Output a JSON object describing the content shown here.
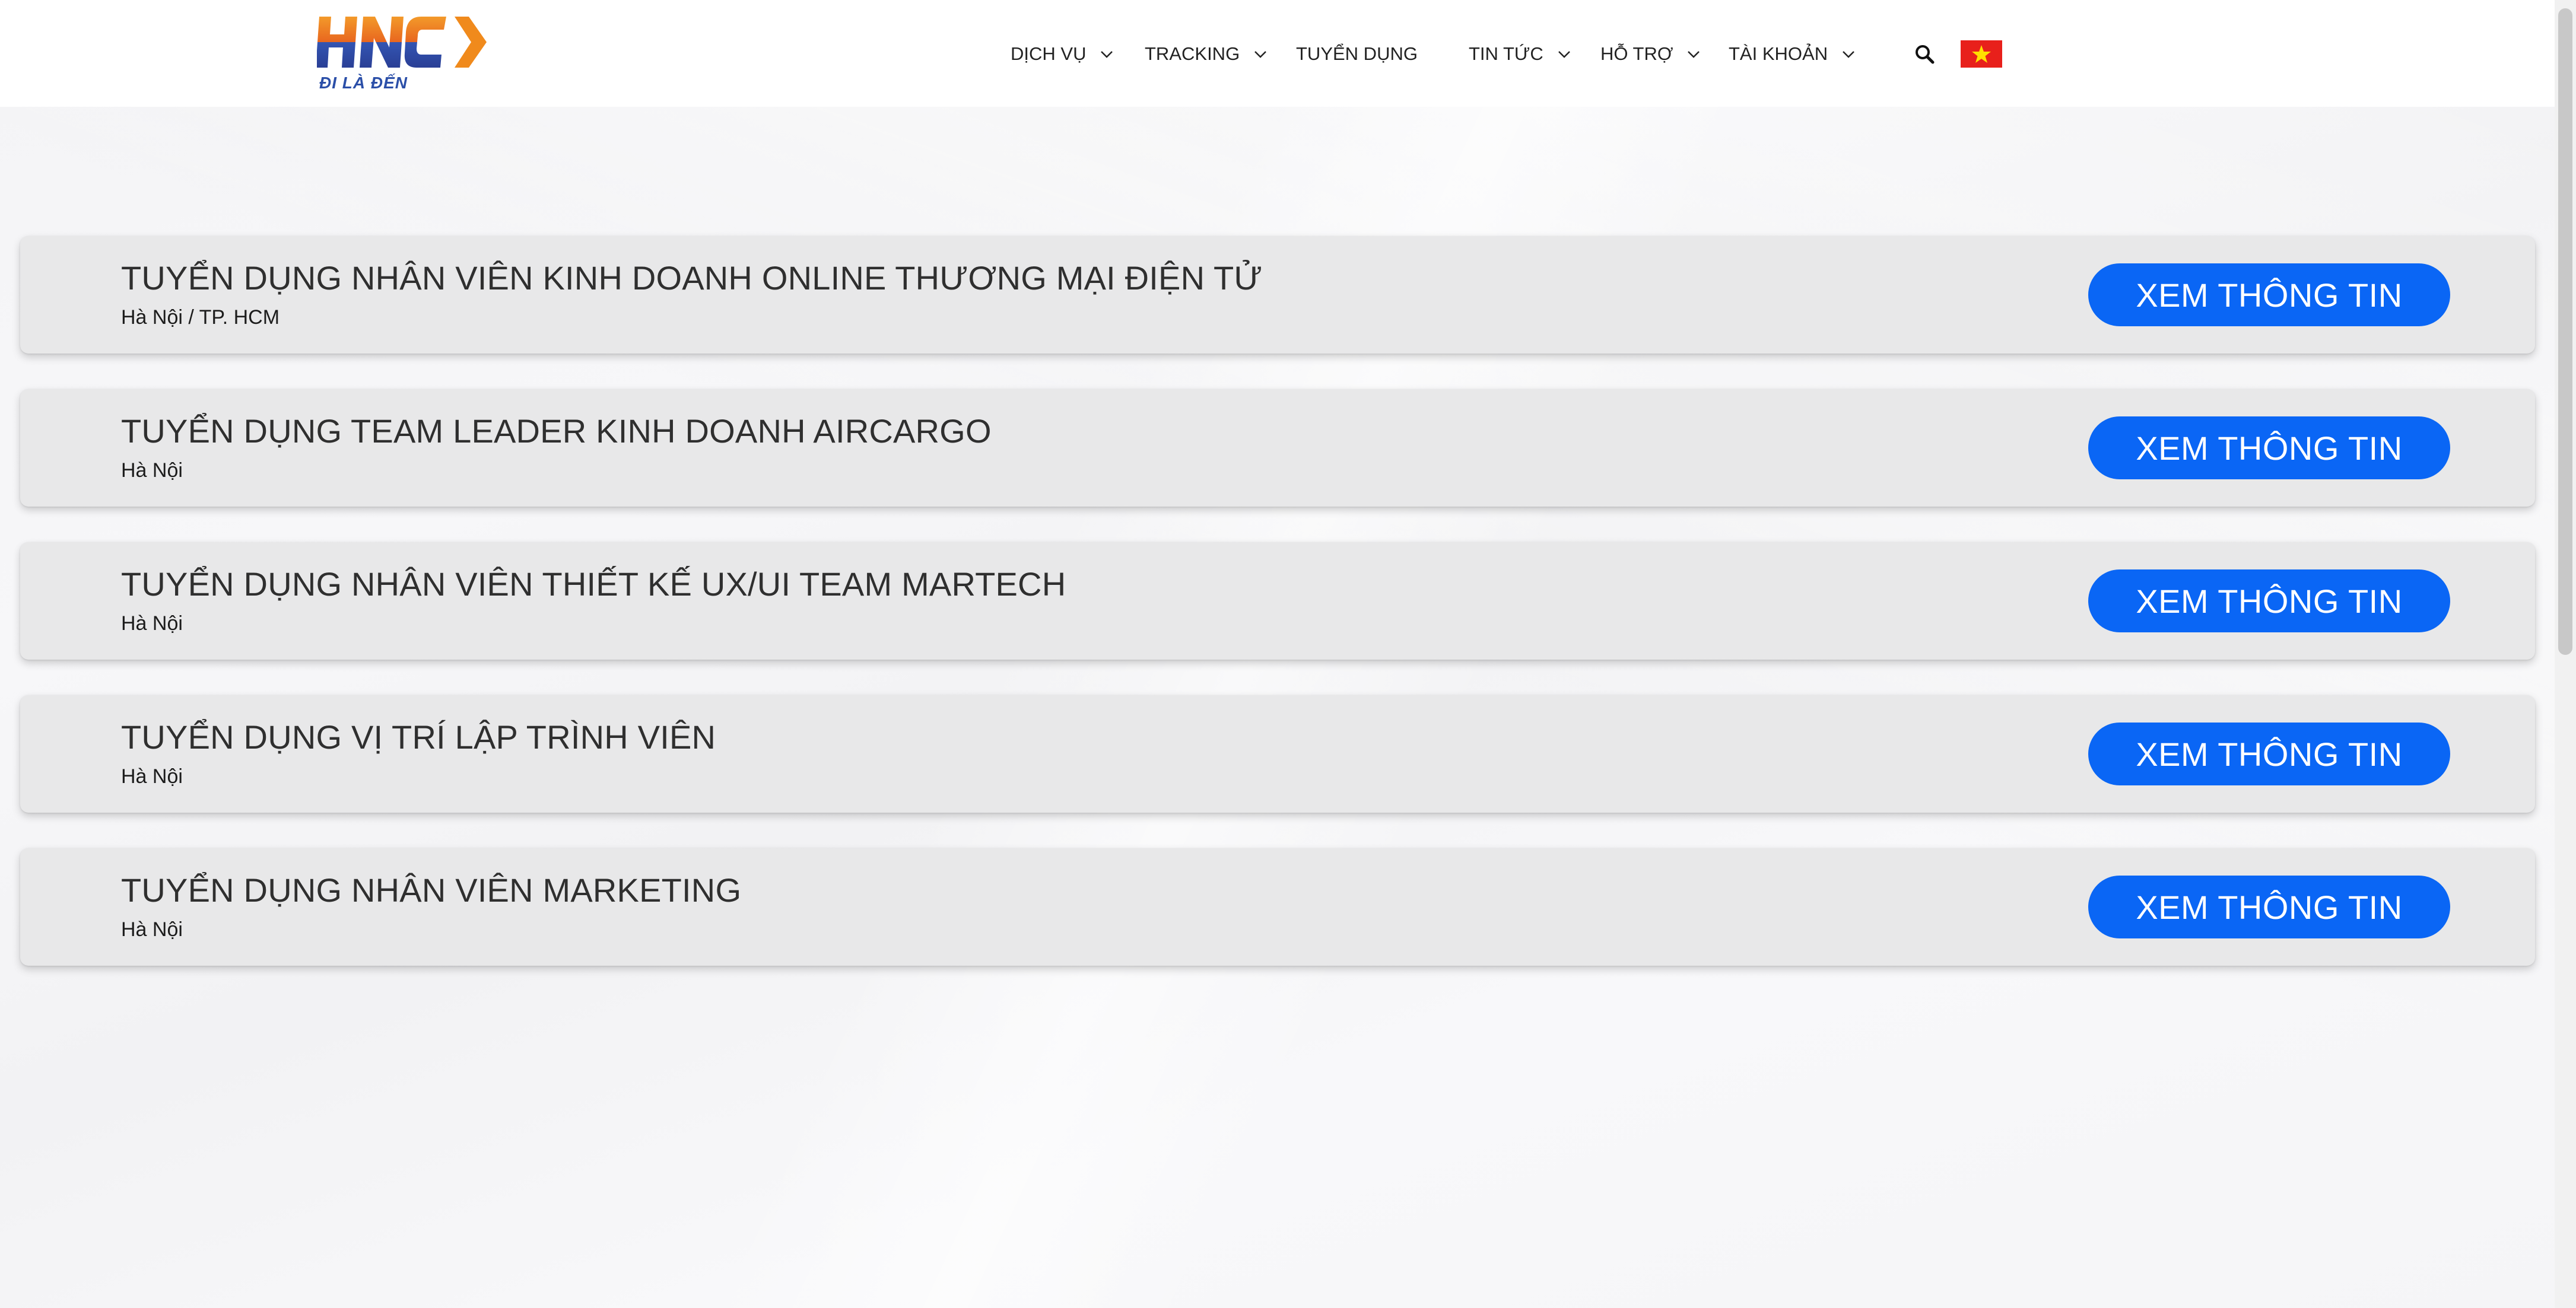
{
  "header": {
    "logo": {
      "brand": "HNC",
      "tagline": "ĐI LÀ ĐẾN"
    },
    "nav": [
      {
        "label": "DỊCH VỤ",
        "has_dropdown": true
      },
      {
        "label": "TRACKING",
        "has_dropdown": true
      },
      {
        "label": "TUYỂN DỤNG",
        "has_dropdown": false
      },
      {
        "label": "TIN TỨC",
        "has_dropdown": true
      },
      {
        "label": "HỖ TRỢ",
        "has_dropdown": true
      },
      {
        "label": "TÀI KHOẢN",
        "has_dropdown": true
      }
    ],
    "search_icon": "search-icon",
    "language_flag": "vietnam-flag-icon"
  },
  "jobs": [
    {
      "title": "TUYỂN DỤNG NHÂN VIÊN KINH DOANH ONLINE THƯƠNG MẠI ĐIỆN TỬ",
      "location": "Hà Nội / TP. HCM",
      "button_label": "XEM THÔNG TIN"
    },
    {
      "title": "TUYỂN DỤNG TEAM LEADER KINH DOANH AIRCARGO",
      "location": "Hà Nội",
      "button_label": "XEM THÔNG TIN"
    },
    {
      "title": "TUYỂN DỤNG NHÂN VIÊN THIẾT KẾ UX/UI TEAM MARTECH",
      "location": "Hà Nội",
      "button_label": "XEM THÔNG TIN"
    },
    {
      "title": "TUYỂN DỤNG VỊ TRÍ LẬP TRÌNH VIÊN",
      "location": "Hà Nội",
      "button_label": "XEM THÔNG TIN"
    },
    {
      "title": "TUYỂN DỤNG NHÂN VIÊN MARKETING",
      "location": "Hà Nội",
      "button_label": "XEM THÔNG TIN"
    }
  ],
  "colors": {
    "primary_button": "#0a66f5",
    "card_bg": "#e8e8e9",
    "logo_orange": "#f08a1c",
    "logo_blue": "#2b4fa8",
    "flag_red": "#e8201b",
    "flag_star": "#ffde00"
  }
}
